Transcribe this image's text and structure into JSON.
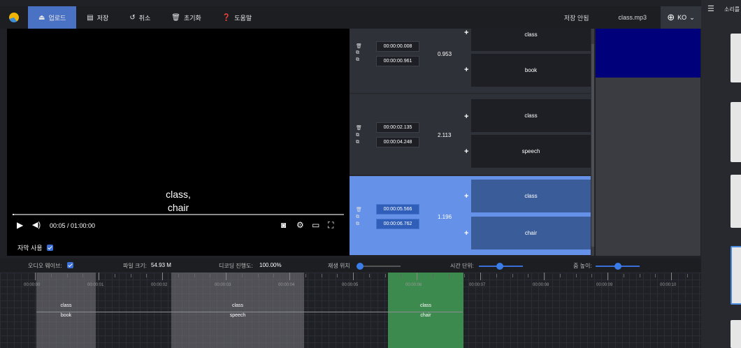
{
  "toolbar": {
    "upload": "업로드",
    "save": "저장",
    "undo": "취소",
    "reset": "초기화",
    "help": "도움말",
    "status": "저장 안됨",
    "filename": "class.mp3",
    "lang": "KO"
  },
  "strip": {
    "title": "소리를"
  },
  "player": {
    "subtitle_line1": "class,",
    "subtitle_line2": "chair",
    "time": "00:05 / 01:00:00",
    "progress": 0.0014
  },
  "subtitle_toggle": {
    "label": "자막 사용"
  },
  "rows": [
    {
      "start": "00:00:00.008",
      "end": "00:00:00.961",
      "duration": "0.953",
      "text1": "class",
      "text2": "book"
    },
    {
      "start": "00:00:02.135",
      "end": "00:00:04.248",
      "duration": "2.113",
      "text1": "class",
      "text2": "speech"
    },
    {
      "start": "00:00:05.566",
      "end": "00:00:06.762",
      "duration": "1.196",
      "text1": "class",
      "text2": "chair"
    }
  ],
  "info": {
    "audio_wave_label": "오디오 웨이브:",
    "file_size_label": "파일 크기:",
    "file_size": "54.93 M",
    "decode_label": "디코딩 진행도:",
    "decode": "100.00%",
    "play_pos_label": "재생 위치",
    "time_unit_label": "시간 단위:",
    "zoom_label": "줌 높이:"
  },
  "timeline": {
    "labels": [
      "00:00:00",
      "00:00:01",
      "00:00:02",
      "00:00:03",
      "00:00:04",
      "00:00:05",
      "00:00:06",
      "00:00:07",
      "00:00:08",
      "00:00:09",
      "00:00:10"
    ],
    "segments": [
      {
        "text1": "class",
        "text2": "book"
      },
      {
        "text1": "class",
        "text2": "speech"
      },
      {
        "text1": "class",
        "text2": "chair"
      }
    ]
  },
  "colors": {
    "accent": "#4a72c4",
    "active_row": "#6592e8",
    "active_segment": "#3d8a4e"
  }
}
